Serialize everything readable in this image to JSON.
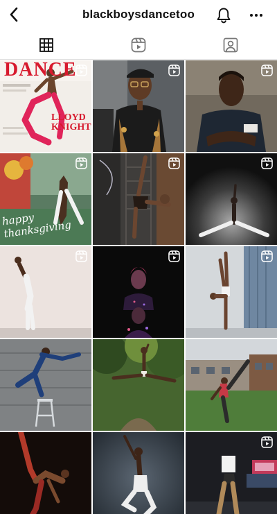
{
  "header": {
    "username": "blackboysdancetoo",
    "back_icon": "chevron-left-icon",
    "notification_icon": "bell-icon",
    "more_icon": "ellipsis-icon"
  },
  "tabs": [
    {
      "name": "posts-grid",
      "icon": "grid-icon",
      "active": true
    },
    {
      "name": "reels",
      "icon": "reels-icon",
      "active": false
    },
    {
      "name": "tagged",
      "icon": "tagged-person-icon",
      "active": false
    }
  ],
  "posts": [
    {
      "id": 1,
      "reel": true,
      "magazine": {
        "masthead": "DANCE",
        "feature_name_line1": "LLOYD",
        "feature_name_line2": "KNIGHT"
      }
    },
    {
      "id": 2,
      "reel": true
    },
    {
      "id": 3,
      "reel": true
    },
    {
      "id": 4,
      "reel": true,
      "caption": "happy thanksgiving"
    },
    {
      "id": 5,
      "reel": true
    },
    {
      "id": 6,
      "reel": true
    },
    {
      "id": 7,
      "reel": true
    },
    {
      "id": 8,
      "reel": true
    },
    {
      "id": 9,
      "reel": true
    },
    {
      "id": 10,
      "reel": false
    },
    {
      "id": 11,
      "reel": false
    },
    {
      "id": 12,
      "reel": false
    },
    {
      "id": 13,
      "reel": false
    },
    {
      "id": 14,
      "reel": false
    },
    {
      "id": 15,
      "reel": true
    }
  ],
  "colors": {
    "text": "#111111",
    "divider": "#dbdbdb",
    "magazine_red": "#d7192d"
  }
}
